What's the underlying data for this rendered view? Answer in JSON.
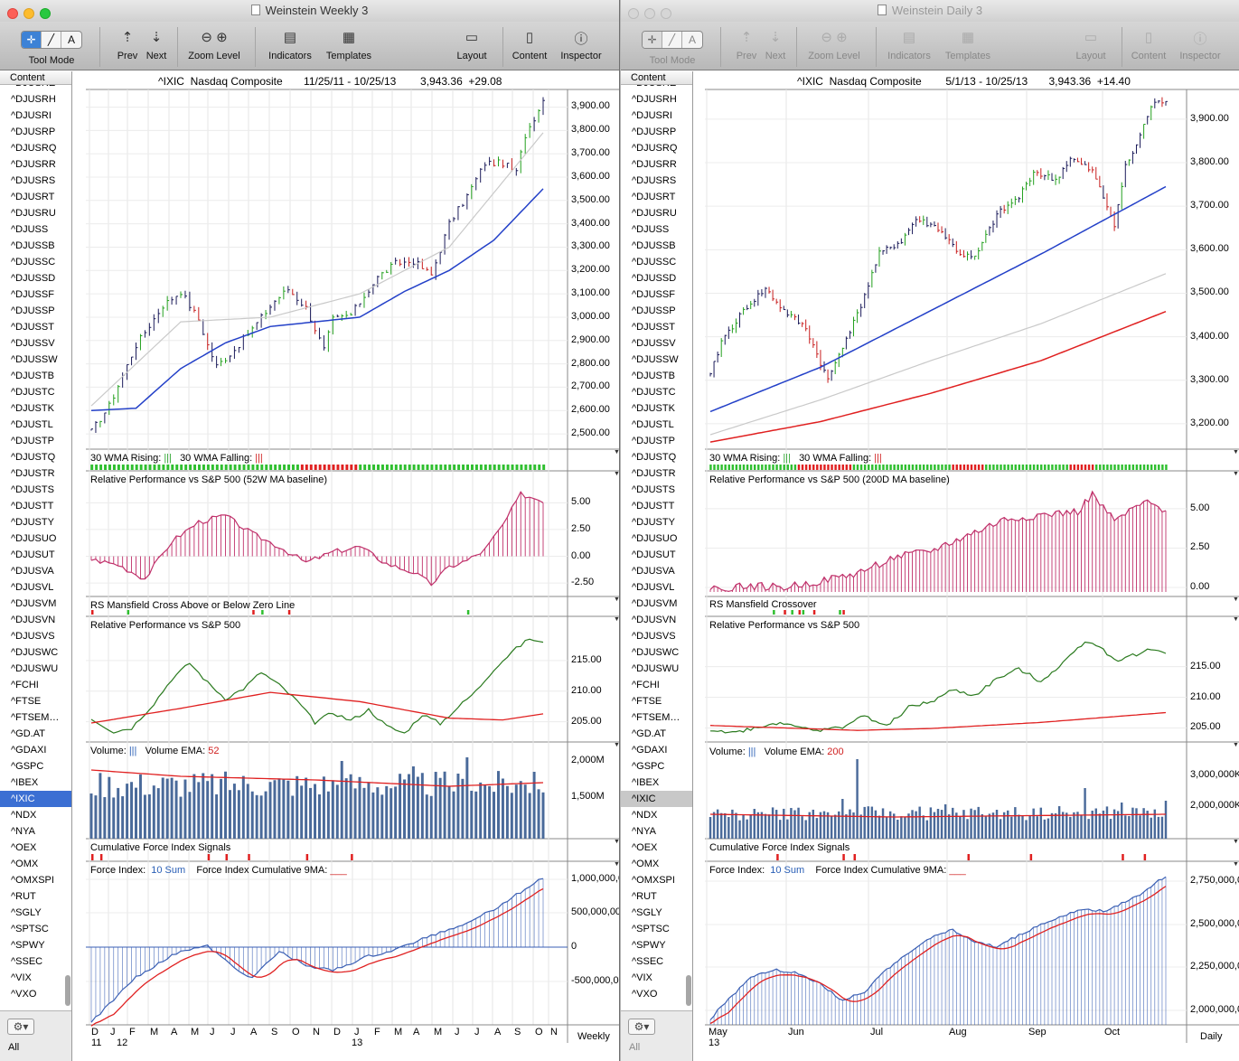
{
  "colors": {
    "price_up": "#23a01e",
    "price_down": "#c81e1e",
    "price_bar": "#1b1b5a",
    "ma_blue": "#2340c8",
    "ma_grey": "#c8c8c8",
    "ma_red": "#e02020",
    "rs_bar": "#c0306a",
    "rp_line": "#2a7a1e",
    "vol_bar": "#4a6a9a",
    "fi_bar": "#3a5fb4",
    "signal_green": "#2fbf2f",
    "signal_red": "#e02020",
    "selection": "#3b6fd3"
  },
  "symbols": [
    "^DJUSRE",
    "^DJUSRH",
    "^DJUSRI",
    "^DJUSRP",
    "^DJUSRQ",
    "^DJUSRR",
    "^DJUSRS",
    "^DJUSRT",
    "^DJUSRU",
    "^DJUSS",
    "^DJUSSB",
    "^DJUSSC",
    "^DJUSSD",
    "^DJUSSF",
    "^DJUSSP",
    "^DJUSST",
    "^DJUSSV",
    "^DJUSSW",
    "^DJUSTB",
    "^DJUSTC",
    "^DJUSTK",
    "^DJUSTL",
    "^DJUSTP",
    "^DJUSTQ",
    "^DJUSTR",
    "^DJUSTS",
    "^DJUSTT",
    "^DJUSTY",
    "^DJUSUO",
    "^DJUSUT",
    "^DJUSVA",
    "^DJUSVL",
    "^DJUSVM",
    "^DJUSVN",
    "^DJUSVS",
    "^DJUSWC",
    "^DJUSWU",
    "^FCHI",
    "^FTSE",
    "^FTSEM…",
    "^GD.AT",
    "^GDAXI",
    "^GSPC",
    "^IBEX",
    "^IXIC",
    "^NDX",
    "^NYA",
    "^OEX",
    "^OMX",
    "^OMXSPI",
    "^RUT",
    "^SGLY",
    "^SPTSC",
    "^SPWY",
    "^SSEC",
    "^VIX",
    "^VXO"
  ],
  "toolbar": {
    "tool_mode": "Tool Mode",
    "prev": "Prev",
    "next": "Next",
    "zoom_level": "Zoom Level",
    "indicators": "Indicators",
    "templates": "Templates",
    "layout": "Layout",
    "content": "Content",
    "inspector": "Inspector",
    "tool_glyphs": [
      "✛",
      "╱",
      "A"
    ]
  },
  "sidebar": {
    "header": "Content",
    "all_label": "All",
    "selected_symbol": "^IXIC"
  },
  "weekly": {
    "title": "Weinstein Weekly 3",
    "header": {
      "symbol": "^IXIC",
      "name": "Nasdaq Composite",
      "range": "11/25/11 - 10/25/13",
      "last": "3,943.36",
      "change": "+29.08"
    },
    "period": "Weekly",
    "price_axis": [
      "3,900.00",
      "3,800.00",
      "3,700.00",
      "3,600.00",
      "3,500.00",
      "3,400.00",
      "3,300.00",
      "3,200.00",
      "3,100.00",
      "3,000.00",
      "2,900.00",
      "2,800.00",
      "2,700.00",
      "2,600.00",
      "2,500.00"
    ],
    "wma_label": {
      "rising": "30 WMA Rising:",
      "rising_mark": "|||",
      "falling": "30 WMA Falling:",
      "falling_mark": "|||"
    },
    "rs_title": "Relative Performance vs S&P 500 (52W MA baseline)",
    "rs_axis": [
      "5.00",
      "2.50",
      "0.00",
      "-2.50"
    ],
    "cross_title": "RS Mansfield Cross Above or Below Zero Line",
    "rp_title": "Relative Performance vs S&P 500",
    "rp_axis": [
      "215.00",
      "210.00",
      "205.00"
    ],
    "vol_label": {
      "volume": "Volume:",
      "volume_mark": "|||",
      "ema": "Volume EMA:",
      "ema_value": "52"
    },
    "vol_axis": [
      "2,000M",
      "1,500M"
    ],
    "cfi_title": "Cumulative Force Index Signals",
    "fi_label": {
      "force": "Force Index:",
      "sum": "10 Sum",
      "cum": "Force Index Cumulative 9MA:",
      "cum_mark": "___"
    },
    "fi_axis": [
      "1,000,000,0",
      "500,000,00",
      "0",
      "-500,000,00"
    ],
    "x_months": [
      "D",
      "J",
      "F",
      "M",
      "A",
      "M",
      "J",
      "J",
      "A",
      "S",
      "O",
      "N",
      "D",
      "J",
      "F",
      "M",
      "A",
      "M",
      "J",
      "J",
      "A",
      "S",
      "O",
      "N"
    ],
    "x_years": [
      "11",
      "12",
      "13"
    ]
  },
  "daily": {
    "title": "Weinstein Daily 3",
    "header": {
      "symbol": "^IXIC",
      "name": "Nasdaq Composite",
      "range": "5/1/13 - 10/25/13",
      "last": "3,943.36",
      "change": "+14.40"
    },
    "period": "Daily",
    "price_axis": [
      "3,900.00",
      "3,800.00",
      "3,700.00",
      "3,600.00",
      "3,500.00",
      "3,400.00",
      "3,300.00",
      "3,200.00"
    ],
    "wma_label": {
      "rising": "30 WMA Rising:",
      "rising_mark": "|||",
      "falling": "30 WMA Falling:",
      "falling_mark": "|||"
    },
    "rs_title": "Relative Performance vs S&P 500 (200D MA baseline)",
    "rs_axis": [
      "5.00",
      "2.50",
      "0.00"
    ],
    "cross_title": "RS Mansfield Crossover",
    "rp_title": "Relative Performance vs S&P 500",
    "rp_axis": [
      "215.00",
      "210.00",
      "205.00"
    ],
    "vol_label": {
      "volume": "Volume:",
      "volume_mark": "|||",
      "ema": "Volume EMA:",
      "ema_value": "200"
    },
    "vol_axis": [
      "3,000,000K",
      "2,000,000K"
    ],
    "cfi_title": "Cumulative Force Index Signals",
    "fi_label": {
      "force": "Force Index:",
      "sum": "10 Sum",
      "cum": "Force Index Cumulative 9MA:",
      "cum_mark": "___"
    },
    "fi_axis": [
      "2,750,000,0",
      "2,500,000,0",
      "2,250,000,0",
      "2,000,000,0"
    ],
    "x_months": [
      "May",
      "Jun",
      "Jul",
      "Aug",
      "Sep",
      "Oct"
    ],
    "x_years": [
      "13"
    ]
  },
  "chart_data": [
    {
      "type": "line",
      "title": "^IXIC Nasdaq Composite 11/25/11 - 10/25/13 (Weekly)",
      "series": [
        {
          "name": "Relative Performance vs S&P 500 (52W MA baseline)",
          "x": [
            0,
            8,
            16,
            24,
            32,
            40,
            48,
            56,
            64,
            72,
            80,
            88,
            96,
            101
          ],
          "values": [
            -0.2,
            -1.8,
            1.5,
            3.6,
            2.1,
            -0.4,
            0.9,
            -0.6,
            -2.1,
            -1.4,
            -2.6,
            0.6,
            5.0,
            5.6
          ]
        },
        {
          "name": "Relative Performance vs S&P 500",
          "x": [
            0,
            8,
            16,
            24,
            32,
            40,
            48,
            56,
            64,
            72,
            80,
            88,
            96,
            101
          ],
          "values": [
            205.3,
            204.0,
            212.0,
            214.2,
            209.6,
            210.5,
            207.1,
            205.6,
            205.0,
            203.5,
            205.7,
            214.5,
            218.2,
            217.6
          ]
        }
      ],
      "ylim": [
        2450,
        3960
      ]
    },
    {
      "type": "line",
      "title": "^IXIC Nasdaq Composite 5/1/13 - 10/25/13 (Daily)",
      "series": [
        {
          "name": "Relative Performance vs S&P 500 (200D MA baseline)",
          "x": [
            0,
            20,
            40,
            60,
            80,
            100,
            120
          ],
          "values": [
            0.0,
            0.6,
            1.4,
            2.8,
            4.2,
            5.8,
            5.0
          ]
        },
        {
          "name": "Relative Performance vs S&P 500",
          "x": [
            0,
            20,
            40,
            60,
            80,
            100,
            120
          ],
          "values": [
            204.5,
            205.6,
            206.0,
            209.6,
            212.8,
            218.6,
            217.3
          ]
        }
      ],
      "ylim": [
        3150,
        3960
      ]
    }
  ]
}
